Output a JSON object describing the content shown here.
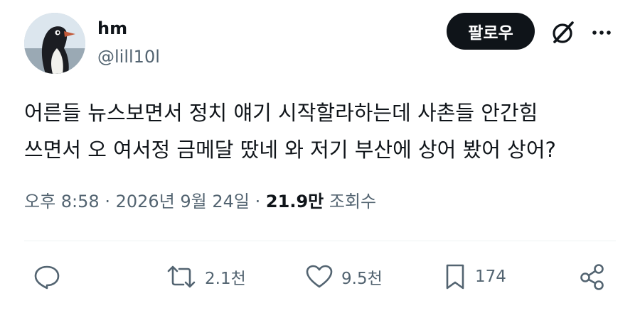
{
  "author": {
    "display_name": "hm",
    "handle": "@lill10l"
  },
  "header": {
    "follow_label": "팔로우"
  },
  "tweet": {
    "lines": [
      "어른들 뉴스보면서 정치 얘기 시작할라하는데 사촌들 안간힘",
      "쓰면서 오 여서정 금메달 땄네 와 저기 부산에 상어 봤어 상어?"
    ]
  },
  "meta": {
    "time": "오후 8:58",
    "separator": "·",
    "date": "2026년 9월 24일",
    "views_count": "21.9만",
    "views_label": "조회수"
  },
  "actions": {
    "reply_count": "",
    "retweet_count": "2.1천",
    "like_count": "9.5천",
    "bookmark_count": "174"
  },
  "icons": [
    "avatar-penguin",
    "grok-icon",
    "more-icon",
    "reply-icon",
    "retweet-icon",
    "like-icon",
    "bookmark-icon",
    "share-icon"
  ],
  "colors": {
    "text": "#0f1419",
    "secondary": "#536471",
    "button_bg": "#0f1419"
  }
}
